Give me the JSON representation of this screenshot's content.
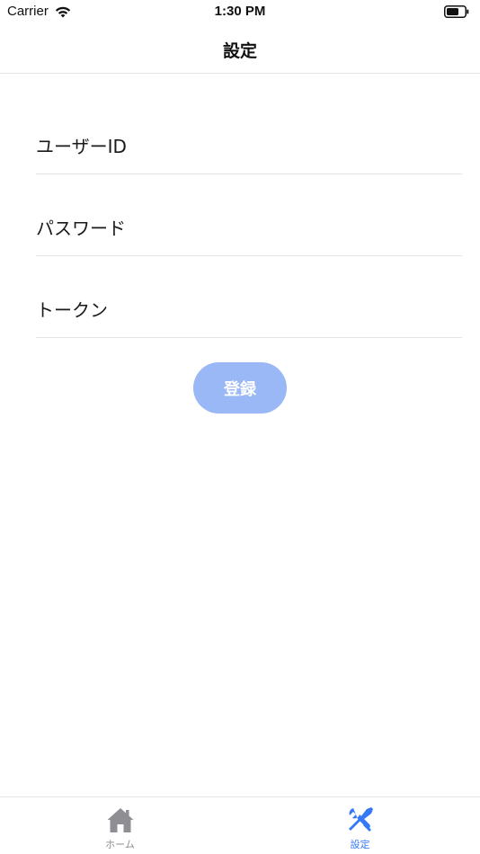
{
  "status_bar": {
    "carrier": "Carrier",
    "time": "1:30 PM"
  },
  "nav": {
    "title": "設定"
  },
  "form": {
    "user_id_placeholder": "ユーザーID",
    "password_placeholder": "パスワード",
    "token_placeholder": "トークン",
    "user_id_value": "",
    "password_value": "",
    "token_value": ""
  },
  "submit": {
    "label": "登録",
    "color": "#9ab8f5"
  },
  "tab_bar": {
    "tabs": [
      {
        "label": "ホーム",
        "icon": "home-icon",
        "active": false
      },
      {
        "label": "設定",
        "icon": "tools-icon",
        "active": true
      }
    ],
    "active_color": "#3478f6",
    "inactive_color": "#8e8e93"
  }
}
